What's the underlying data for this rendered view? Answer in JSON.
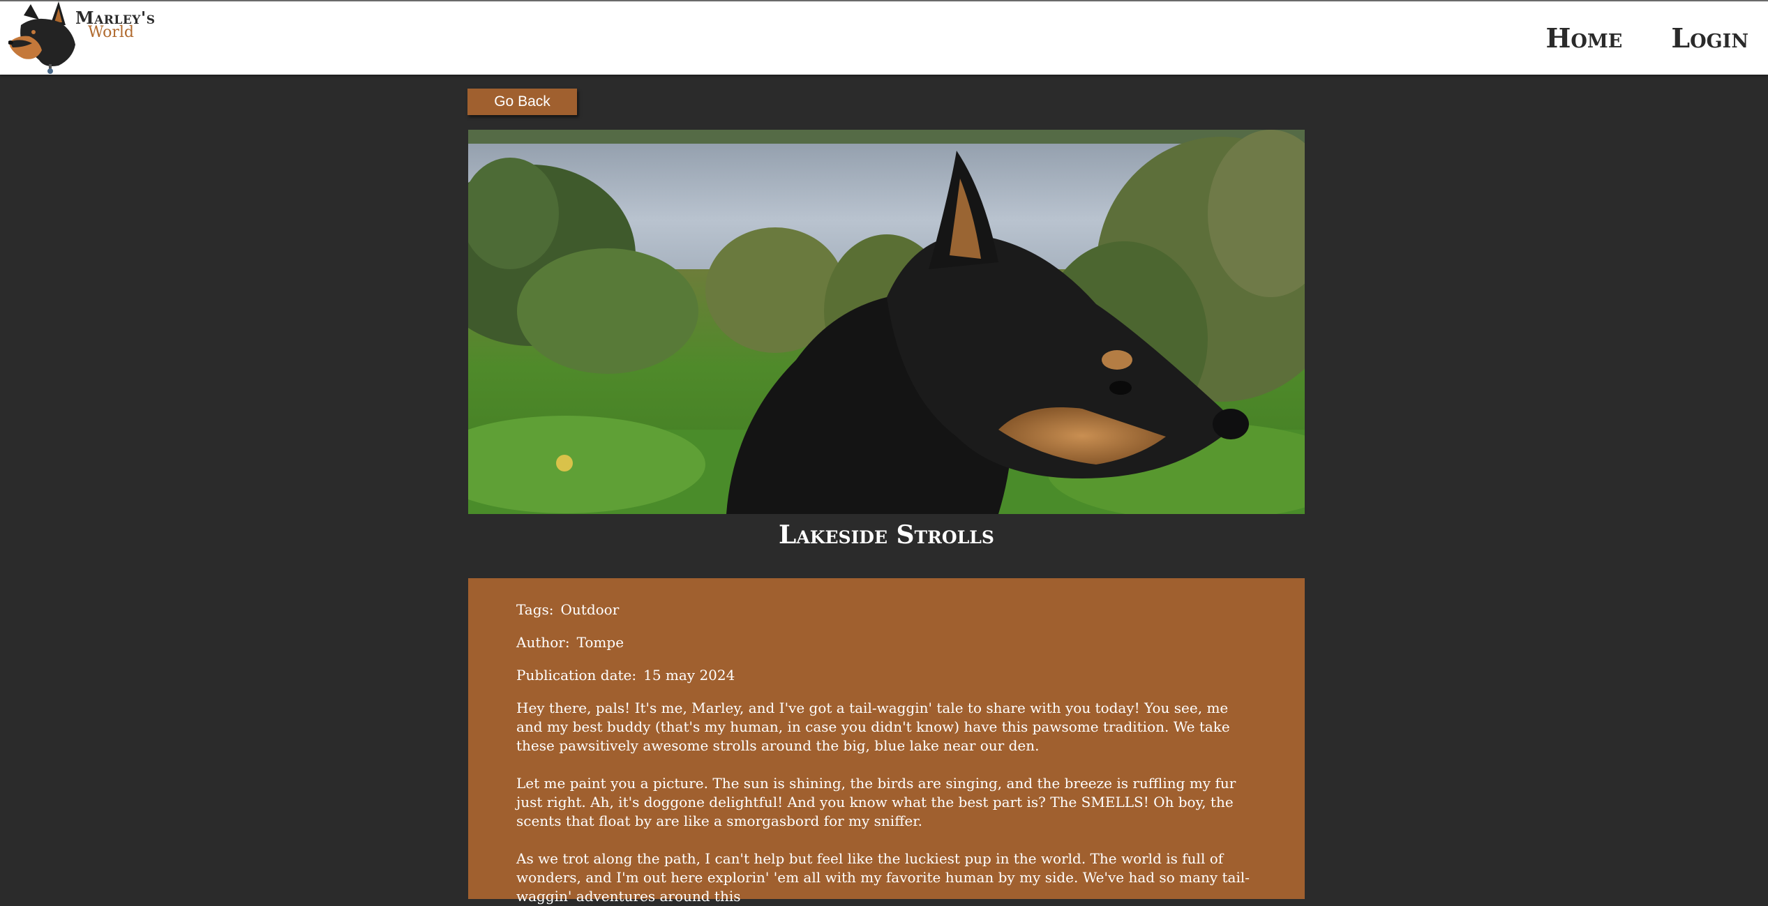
{
  "brand": {
    "line1": "Marley's",
    "line2": "World"
  },
  "nav": {
    "home": "Home",
    "login": "Login"
  },
  "back_button": "Go Back",
  "post": {
    "image_alt": "Black and tan dog beside a lake",
    "title": "Lakeside Strolls",
    "tags_label": "Tags:",
    "tags": "Outdoor",
    "author_label": "Author:",
    "author": "Tompe",
    "date_label": "Publication date:",
    "date": "15 may 2024",
    "paragraphs": [
      "Hey there, pals! It's me, Marley, and I've got a tail-waggin' tale to share with you today! You see, me and my best buddy (that's my human, in case you didn't know) have this pawsome tradition. We take these pawsitively awesome strolls around the big, blue lake near our den.",
      "Let me paint you a picture. The sun is shining, the birds are singing, and the breeze is ruffling my fur just right. Ah, it's doggone delightful! And you know what the best part is? The SMELLS! Oh boy, the scents that float by are like a smorgasbord for my sniffer.",
      "As we trot along the path, I can't help but feel like the luckiest pup in the world. The world is full of wonders, and I'm out here explorin' 'em all with my favorite human by my side. We've had so many tail-waggin' adventures around this"
    ]
  },
  "colors": {
    "accent": "#a0602f",
    "background": "#2b2b2b",
    "header": "#ffffff"
  }
}
